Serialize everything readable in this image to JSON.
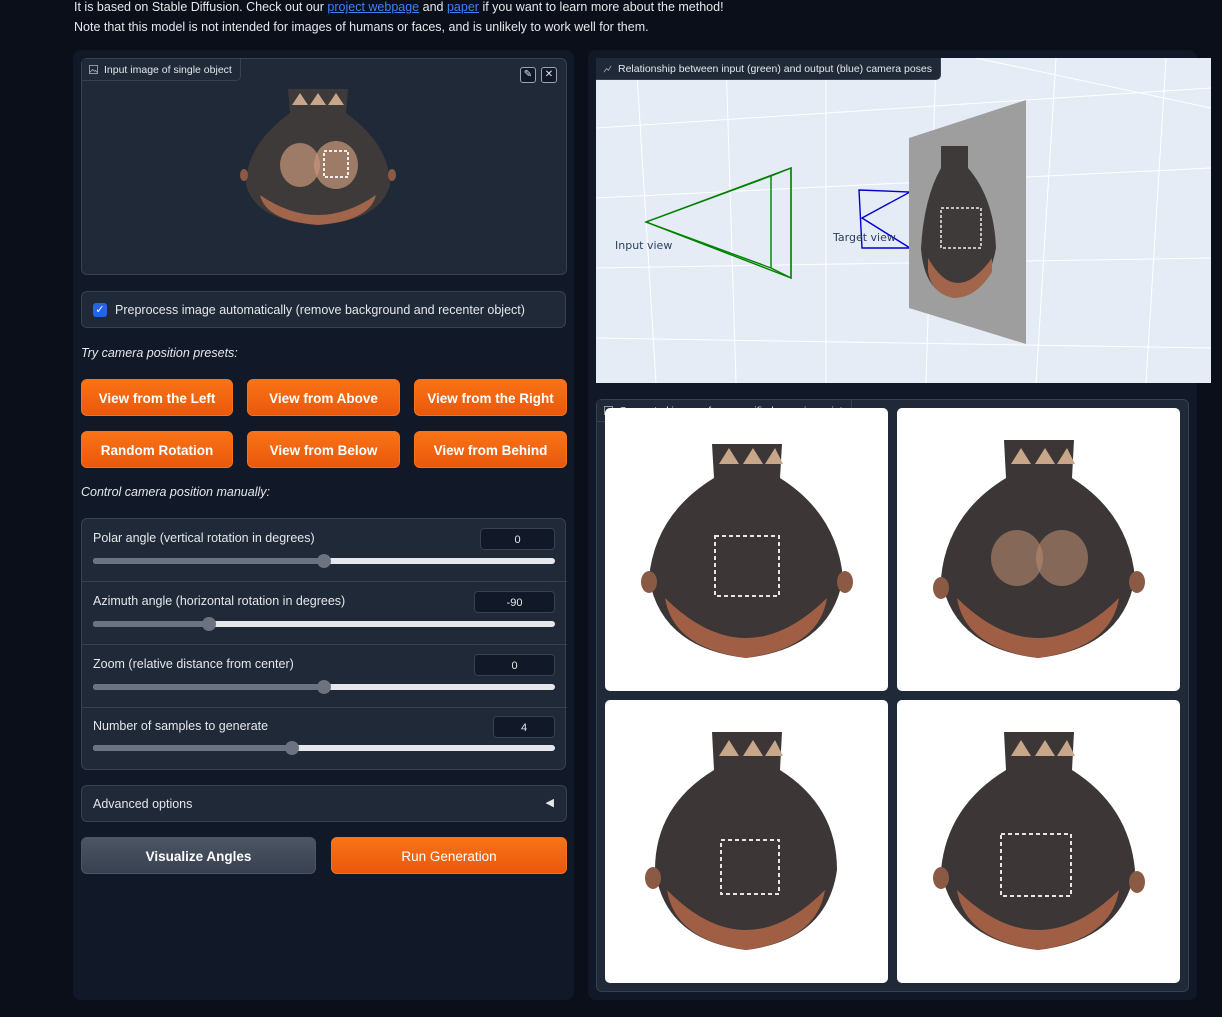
{
  "intro": {
    "line1_prefix": "It is based on Stable Diffusion. Check out our",
    "link_project": "project webpage",
    "line1_and": "and",
    "link_paper": "paper",
    "line1_suffix": "if you want to learn more about the method!",
    "line2": "Note that this model is not intended for images of humans or faces, and is unlikely to work well for them."
  },
  "input_image": {
    "label": "Input image of single object",
    "edit_icon": "pencil-icon",
    "clear_icon": "close-icon"
  },
  "preprocess": {
    "label": "Preprocess image automatically (remove background and recenter object)",
    "checked": true
  },
  "presets": {
    "title": "Try camera position presets:",
    "buttons": [
      "View from the Left",
      "View from Above",
      "View from the Right",
      "Random Rotation",
      "View from Below",
      "View from Behind"
    ]
  },
  "manual": {
    "title": "Control camera position manually:",
    "sliders": [
      {
        "label": "Polar angle (vertical rotation in degrees)",
        "value": "0",
        "fraction": 0.5
      },
      {
        "label": "Azimuth angle (horizontal rotation in degrees)",
        "value": "-90",
        "fraction": 0.25
      },
      {
        "label": "Zoom (relative distance from center)",
        "value": "0",
        "fraction": 0.5
      },
      {
        "label": "Number of samples to generate",
        "value": "4",
        "fraction": 0.43
      }
    ]
  },
  "advanced": {
    "label": "Advanced options",
    "arrow": "◀"
  },
  "actions": {
    "visualize": "Visualize Angles",
    "run": "Run Generation"
  },
  "plot": {
    "label": "Relationship between input (green) and output (blue) camera poses",
    "input_view_label": "Input view",
    "target_view_label": "Target view",
    "colors": {
      "input": "#008000",
      "target": "#0000cc",
      "background": "#e5ecf6"
    }
  },
  "gallery": {
    "label": "Generated images from specified new viewpoint",
    "count": 4
  }
}
